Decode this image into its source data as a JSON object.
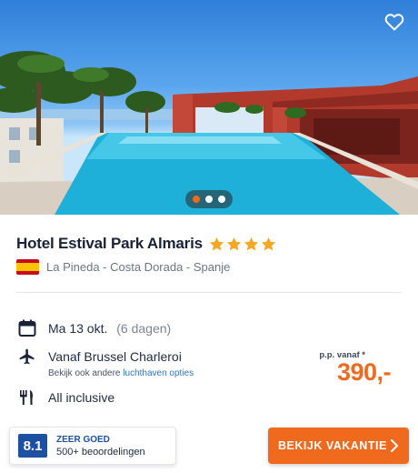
{
  "hotel": {
    "name": "Hotel Estival Park Almaris",
    "star_count": 4,
    "location": "La Pineda - Costa Dorada - Spanje",
    "country_flag": "spain-flag"
  },
  "gallery": {
    "image_count": 3,
    "active_index": 0
  },
  "details": {
    "date": "Ma 13 okt.",
    "duration": "(6 dagen)",
    "departure": "Vanaf Brussel Charleroi",
    "airport_hint": "Bekijk ook andere",
    "airport_link": "luchthaven opties",
    "board": "All inclusive"
  },
  "price": {
    "label": "p.p. vanaf *",
    "amount": "390,-"
  },
  "rating": {
    "score": "8.1",
    "level": "ZEER GOED",
    "count": "500+ beoordelingen"
  },
  "cta": {
    "label": "BEKIJK VAKANTIE"
  },
  "colors": {
    "accent": "#f06a1d",
    "star": "#f5a623",
    "rating_blue": "#1d4fa3",
    "link": "#2b77cf"
  },
  "icons": [
    "heart-icon",
    "star-icon",
    "calendar-icon",
    "plane-icon",
    "cutlery-icon",
    "chevron-right-icon"
  ]
}
